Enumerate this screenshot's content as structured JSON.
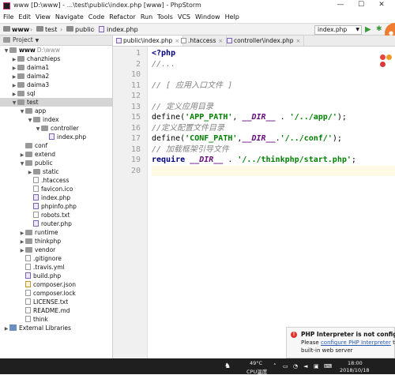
{
  "window": {
    "title": "www [D:\\www] - ...\\test\\public\\index.php [www] - PhpStorm",
    "controls": {
      "minimize": "—",
      "maximize": "☐",
      "close": "✕"
    }
  },
  "menu": [
    "File",
    "Edit",
    "View",
    "Navigate",
    "Code",
    "Refactor",
    "Run",
    "Tools",
    "VCS",
    "Window",
    "Help"
  ],
  "breadcrumbs": [
    "www",
    "test",
    "public",
    "index.php"
  ],
  "run_config": "index.php",
  "project_panel": {
    "label": "Project"
  },
  "tree": [
    {
      "label": "www",
      "path": "D:\\www",
      "depth": 0,
      "kind": "folder",
      "expanded": true
    },
    {
      "label": "chanzhieps",
      "depth": 1,
      "kind": "folder",
      "expanded": false
    },
    {
      "label": "daima1",
      "depth": 1,
      "kind": "folder",
      "expanded": false
    },
    {
      "label": "daima2",
      "depth": 1,
      "kind": "folder",
      "expanded": false
    },
    {
      "label": "daima3",
      "depth": 1,
      "kind": "folder",
      "expanded": false
    },
    {
      "label": "sql",
      "depth": 1,
      "kind": "folder",
      "expanded": false
    },
    {
      "label": "test",
      "depth": 1,
      "kind": "folder",
      "expanded": true,
      "selected": true
    },
    {
      "label": "app",
      "depth": 2,
      "kind": "folder",
      "expanded": true
    },
    {
      "label": "index",
      "depth": 3,
      "kind": "folder",
      "expanded": true
    },
    {
      "label": "controller",
      "depth": 4,
      "kind": "folder",
      "expanded": true
    },
    {
      "label": "index.php",
      "depth": 5,
      "kind": "php"
    },
    {
      "label": "conf",
      "depth": 2,
      "kind": "folder"
    },
    {
      "label": "extend",
      "depth": 2,
      "kind": "folder",
      "expanded": false
    },
    {
      "label": "public",
      "depth": 2,
      "kind": "folder",
      "expanded": true
    },
    {
      "label": "static",
      "depth": 3,
      "kind": "folder",
      "expanded": false
    },
    {
      "label": ".htaccess",
      "depth": 3,
      "kind": "file"
    },
    {
      "label": "favicon.ico",
      "depth": 3,
      "kind": "file"
    },
    {
      "label": "index.php",
      "depth": 3,
      "kind": "php"
    },
    {
      "label": "phpinfo.php",
      "depth": 3,
      "kind": "php"
    },
    {
      "label": "robots.txt",
      "depth": 3,
      "kind": "file"
    },
    {
      "label": "router.php",
      "depth": 3,
      "kind": "php"
    },
    {
      "label": "runtime",
      "depth": 2,
      "kind": "folder",
      "expanded": false
    },
    {
      "label": "thinkphp",
      "depth": 2,
      "kind": "folder",
      "expanded": false
    },
    {
      "label": "vendor",
      "depth": 2,
      "kind": "folder",
      "expanded": false
    },
    {
      "label": ".gitignore",
      "depth": 2,
      "kind": "file"
    },
    {
      "label": ".travis.yml",
      "depth": 2,
      "kind": "file"
    },
    {
      "label": "build.php",
      "depth": 2,
      "kind": "php"
    },
    {
      "label": "composer.json",
      "depth": 2,
      "kind": "json"
    },
    {
      "label": "composer.lock",
      "depth": 2,
      "kind": "file"
    },
    {
      "label": "LICENSE.txt",
      "depth": 2,
      "kind": "file"
    },
    {
      "label": "README.md",
      "depth": 2,
      "kind": "file"
    },
    {
      "label": "think",
      "depth": 2,
      "kind": "file"
    },
    {
      "label": "External Libraries",
      "depth": 0,
      "kind": "lib",
      "expanded": false
    }
  ],
  "tabs": [
    {
      "label": "public\\index.php",
      "active": true
    },
    {
      "label": ".htaccess",
      "active": false
    },
    {
      "label": "controller\\index.php",
      "active": false
    }
  ],
  "code_lines": [
    {
      "n": "1",
      "segments": [
        {
          "t": "<?php",
          "c": "k"
        }
      ]
    },
    {
      "n": "2",
      "segments": [
        {
          "t": "//...",
          "c": "cm"
        }
      ]
    },
    {
      "n": "10",
      "segments": []
    },
    {
      "n": "11",
      "segments": [
        {
          "t": "// [ 应用入口文件 ]",
          "c": "cm"
        }
      ]
    },
    {
      "n": "12",
      "segments": []
    },
    {
      "n": "13",
      "segments": [
        {
          "t": "// 定义应用目录",
          "c": "cm"
        }
      ]
    },
    {
      "n": "15",
      "segments": [
        {
          "t": "define(",
          "c": "fn"
        },
        {
          "t": "'APP_PATH'",
          "c": "s"
        },
        {
          "t": ", ",
          "c": "fn"
        },
        {
          "t": "__DIR__",
          "c": "c"
        },
        {
          "t": " . ",
          "c": "fn"
        },
        {
          "t": "'/../app/'",
          "c": "s"
        },
        {
          "t": ");",
          "c": "fn"
        }
      ]
    },
    {
      "n": "16",
      "segments": [
        {
          "t": "//定义配置文件目录",
          "c": "cm"
        }
      ]
    },
    {
      "n": "17",
      "segments": [
        {
          "t": "define(",
          "c": "fn"
        },
        {
          "t": "'CONF_PATH'",
          "c": "s"
        },
        {
          "t": ",",
          "c": "fn"
        },
        {
          "t": "__DIR__",
          "c": "c"
        },
        {
          "t": ".",
          "c": "fn"
        },
        {
          "t": "'/../conf/'",
          "c": "s"
        },
        {
          "t": ");",
          "c": "fn"
        }
      ]
    },
    {
      "n": "18",
      "segments": [
        {
          "t": "// 加载框架引导文件",
          "c": "cm"
        }
      ]
    },
    {
      "n": "19",
      "segments": [
        {
          "t": "require ",
          "c": "k"
        },
        {
          "t": "__DIR__",
          "c": "c"
        },
        {
          "t": " . ",
          "c": "fn"
        },
        {
          "t": "'/../thinkphp/start.php'",
          "c": "s"
        },
        {
          "t": ";",
          "c": "fn"
        }
      ]
    },
    {
      "n": "20",
      "segments": [],
      "current": true
    }
  ],
  "notification": {
    "title": "PHP Interpreter is not configured",
    "prefix": "Please ",
    "link": "configure PHP Interpreter",
    "suffix": " to",
    "line2": "built-in web server"
  },
  "taskbar": {
    "weather": "49°C",
    "weather_sub": "CPU温度",
    "time": "18:00",
    "date": "2018/10/18"
  },
  "colors": {
    "keyword": "#000080",
    "string": "#008000",
    "constant": "#660e7a",
    "comment": "#808080",
    "error": "#e0312b",
    "link": "#2a5db0"
  }
}
